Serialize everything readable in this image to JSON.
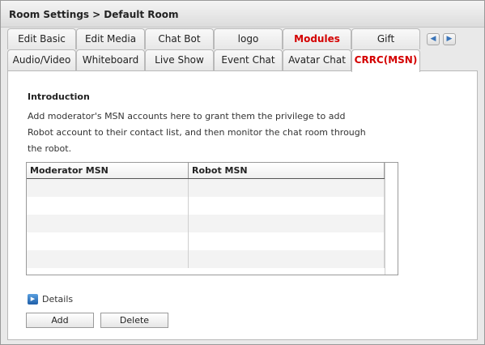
{
  "titlebar": {
    "title": "Room Settings",
    "breadcrumb": "> Default Room"
  },
  "tabs": {
    "row1": [
      {
        "label": "Edit Basic",
        "style": "normal"
      },
      {
        "label": "Edit Media",
        "style": "normal"
      },
      {
        "label": "Chat Bot",
        "style": "normal"
      },
      {
        "label": "logo",
        "style": "normal"
      },
      {
        "label": "Modules",
        "style": "red"
      },
      {
        "label": "Gift",
        "style": "normal"
      }
    ],
    "row2": [
      {
        "label": "Audio/Video",
        "style": "normal"
      },
      {
        "label": "Whiteboard",
        "style": "normal"
      },
      {
        "label": "Live Show",
        "style": "normal"
      },
      {
        "label": "Event Chat",
        "style": "normal"
      },
      {
        "label": "Avatar Chat",
        "style": "normal"
      },
      {
        "label": "CRRC(MSN)",
        "style": "red-active"
      }
    ],
    "nav": {
      "prev_icon": "left-arrow-icon",
      "next_icon": "right-arrow-icon"
    }
  },
  "content": {
    "intro_title": "Introduction",
    "intro_text": "Add moderator's MSN accounts here to grant them the privilege to add Robot account to their contact list, and then monitor the chat room through the robot.",
    "table": {
      "columns": [
        "Moderator MSN",
        "Robot MSN"
      ],
      "rows": [
        [
          "",
          ""
        ],
        [
          "",
          ""
        ],
        [
          "",
          ""
        ],
        [
          "",
          ""
        ],
        [
          "",
          ""
        ]
      ]
    },
    "details_label": "Details",
    "details_icon": "play-arrow-icon",
    "add_label": "Add",
    "delete_label": "Delete"
  },
  "colors": {
    "accent_red": "#d40000",
    "panel": "#ffffff",
    "chrome": "#e9e9e9"
  }
}
